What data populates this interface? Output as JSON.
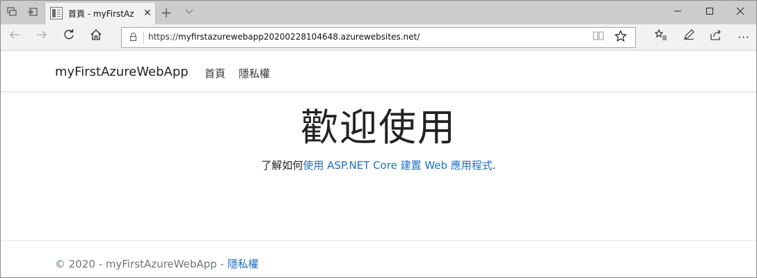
{
  "browser": {
    "tab_title": "首頁 - myFirstAz",
    "url_prefix": "https://",
    "url_rest": "myfirstazurewebapp20200228104648.azurewebsites.net/"
  },
  "site": {
    "brand": "myFirstAzureWebApp",
    "nav": [
      "首頁",
      "隱私權"
    ]
  },
  "main": {
    "heading": "歡迎使用",
    "learn_prefix": "了解如何",
    "learn_link": "使用 ASP.NET Core 建置 Web 應用程式",
    "learn_suffix": "."
  },
  "footer": {
    "text": "© 2020 - myFirstAzureWebApp - ",
    "privacy_link": "隱私權"
  },
  "colors": {
    "link": "#1b6ec2",
    "tabstrip": "#cccccc",
    "toolbar": "#f2f2f2"
  },
  "icons": [
    "tab-preview-icon",
    "set-aside-tabs-icon",
    "new-tab-icon",
    "tab-list-chevron-icon",
    "minimize-icon",
    "maximize-icon",
    "close-window-icon",
    "back-icon",
    "forward-icon",
    "refresh-icon",
    "home-icon",
    "lock-icon",
    "reading-view-icon",
    "favorite-star-icon",
    "favorites-hub-icon",
    "pen-icon",
    "share-icon",
    "more-icon"
  ]
}
